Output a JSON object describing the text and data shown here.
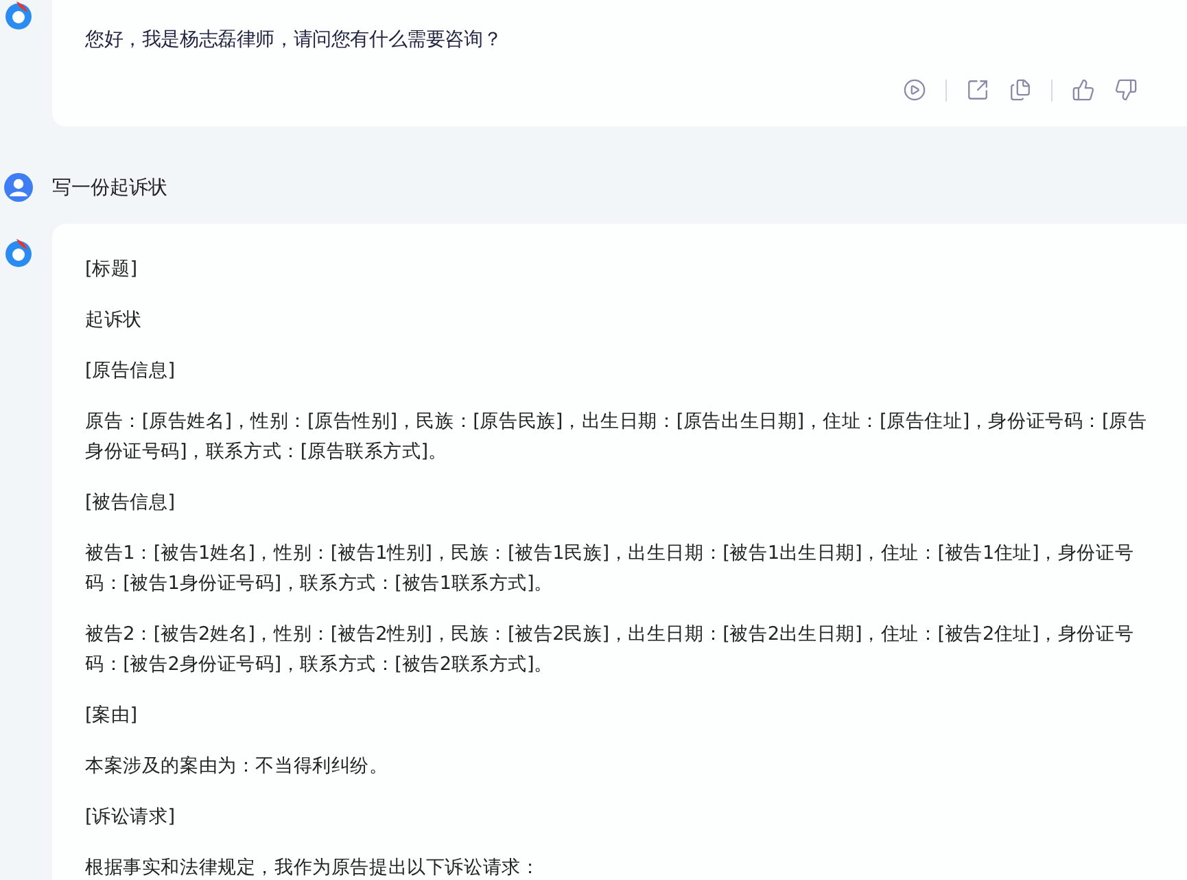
{
  "messages": [
    {
      "kind": "bot",
      "paragraphs": [
        "您好，我是杨志磊律师，请问您有什么需要咨询？"
      ],
      "actions": [
        {
          "kind": "play"
        },
        {
          "kind": "separator"
        },
        {
          "kind": "share"
        },
        {
          "kind": "copy"
        },
        {
          "kind": "separator"
        },
        {
          "kind": "like"
        },
        {
          "kind": "dislike"
        }
      ]
    },
    {
      "kind": "user",
      "paragraphs": [
        "写一份起诉状"
      ]
    },
    {
      "kind": "bot",
      "paragraphs": [
        "[标题]",
        "起诉状",
        "[原告信息]",
        "原告：[原告姓名]，性别：[原告性别]，民族：[原告民族]，出生日期：[原告出生日期]，住址：[原告住址]，身份证号码：[原告身份证号码]，联系方式：[原告联系方式]。",
        "[被告信息]",
        "被告1：[被告1姓名]，性别：[被告1性别]，民族：[被告1民族]，出生日期：[被告1出生日期]，住址：[被告1住址]，身份证号码：[被告1身份证号码]，联系方式：[被告1联系方式]。",
        "被告2：[被告2姓名]，性别：[被告2性别]，民族：[被告2民族]，出生日期：[被告2出生日期]，住址：[被告2住址]，身份证号码：[被告2身份证号码]，联系方式：[被告2联系方式]。",
        "[案由]",
        "本案涉及的案由为：不当得利纠纷。",
        "[诉讼请求]",
        "根据事实和法律规定，我作为原告提出以下诉讼请求："
      ]
    }
  ]
}
